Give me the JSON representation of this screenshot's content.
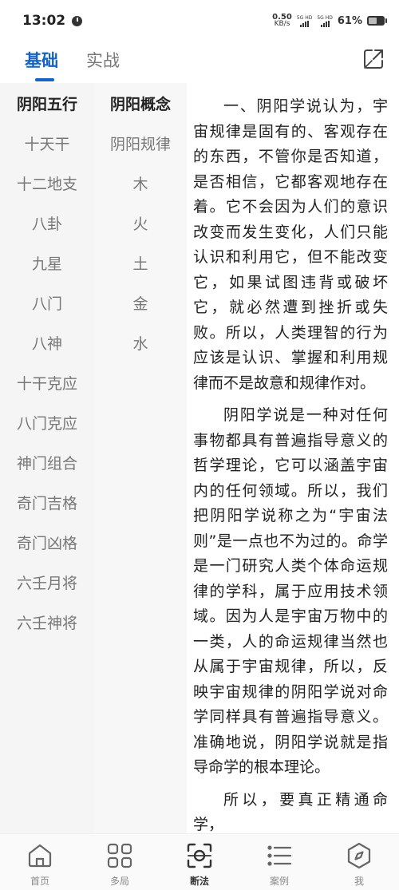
{
  "status": {
    "time": "13:02",
    "net_speed_value": "0.50",
    "net_speed_unit": "KB/s",
    "sim1_label": "5G HD",
    "sim2_label": "5G HD",
    "battery_pct": "61%"
  },
  "tabs": [
    {
      "label": "基础",
      "active": true
    },
    {
      "label": "实战",
      "active": false
    }
  ],
  "sidebar": {
    "items": [
      "阴阳五行",
      "十天干",
      "十二地支",
      "八卦",
      "九星",
      "八门",
      "八神",
      "十干克应",
      "八门克应",
      "神门组合",
      "奇门吉格",
      "奇门凶格",
      "六壬月将",
      "六壬神将"
    ],
    "active_index": 0
  },
  "subnav": {
    "items": [
      "阴阳概念",
      "阴阳规律",
      "木",
      "火",
      "土",
      "金",
      "水"
    ],
    "active_index": 0
  },
  "content": {
    "paragraphs": [
      "一、阴阳学说认为，宇宙规律是固有的、客观存在的东西，不管你是否知道，是否相信，它都客观地存在着。它不会因为人们的意识改变而发生变化，人们只能认识和利用它，但不能改变它，如果试图违背或破坏它，就必然遭到挫折或失败。所以，人类理智的行为应该是认识、掌握和利用规律而不是故意和规律作对。",
      "阴阳学说是一种对任何事物都具有普遍指导意义的哲学理论，它可以涵盖宇宙内的任何领域。所以，我们把阴阳学说称之为“宇宙法则”是一点也不为过的。命学是一门研究人类个体命运规律的学科，属于应用技术领域。因为人是宇宙万物中的一类，人的命运规律当然也从属于宇宙规律，所以，反映宇宙规律的阴阳学说对命学同样具有普遍指导意义。准确地说，阴阳学说就是指导命学的根本理论。",
      "所以，要真正精通命学，"
    ]
  },
  "bottom_nav": {
    "items": [
      {
        "label": "首页",
        "icon": "home-icon"
      },
      {
        "label": "多局",
        "icon": "grid-icon"
      },
      {
        "label": "断法",
        "icon": "scan-icon"
      },
      {
        "label": "案例",
        "icon": "list-icon"
      },
      {
        "label": "我",
        "icon": "compass-icon"
      }
    ],
    "active_index": 2
  },
  "colors": {
    "accent": "#1565c0",
    "text": "#222222",
    "muted": "#777777",
    "sidebar_bg": "#f5f5f5"
  }
}
